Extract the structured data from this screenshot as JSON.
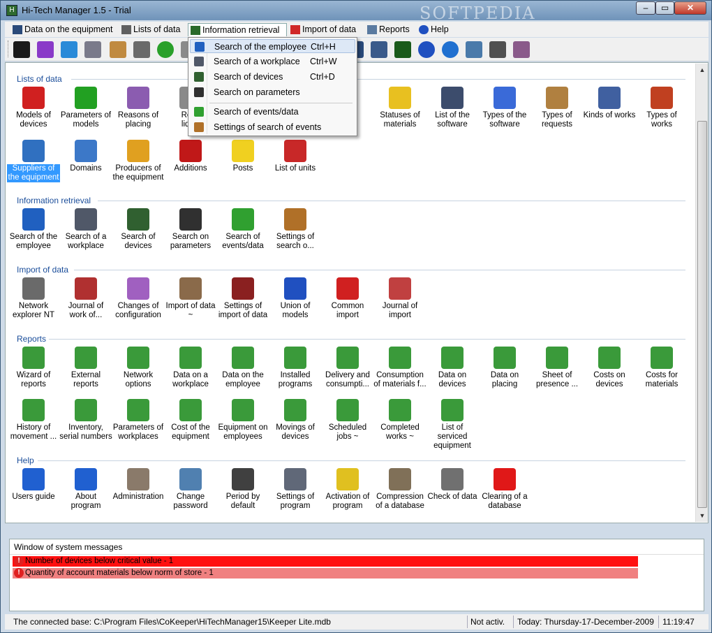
{
  "window": {
    "title": "Hi-Tech Manager 1.5 - Trial",
    "watermark": "SOFTPEDIA",
    "min_glyph": "‒",
    "max_glyph": "▭",
    "close_glyph": "✕"
  },
  "menu": {
    "data_equipment": "Data on the equipment",
    "lists": "Lists of data",
    "info": "Information retrieval",
    "import": "Import of data",
    "reports": "Reports",
    "help": "Help"
  },
  "toolbar": {
    "icons": [
      "tree-icon",
      "cube-purple-icon",
      "cube-blue-icon",
      "doors-icon",
      "pencil-book-icon",
      "clipboard-icon",
      "checkmark-icon",
      "hidden-icon",
      "hidden-icon",
      "hidden-icon",
      "hidden-icon",
      "hidden-icon",
      "hidden-icon",
      "hidden-icon",
      "hidden-icon",
      "hidden-icon",
      "hidden-icon",
      "hidden-icon",
      "hidden-icon",
      "computer-icon",
      "binoculars-icon",
      "help-icon",
      "info-icon",
      "stamp-icon",
      "magnifier-icon",
      "mug-icon"
    ]
  },
  "dropdown": {
    "items": [
      {
        "label": "Search of the employee",
        "shortcut": "Ctrl+H",
        "icon": "employee-icon"
      },
      {
        "label": "Search of a workplace",
        "shortcut": "Ctrl+W",
        "icon": "workplace-icon"
      },
      {
        "label": "Search of devices",
        "shortcut": "Ctrl+D",
        "icon": "binoculars-icon"
      },
      {
        "label": "Search on parameters",
        "shortcut": "",
        "icon": "binoculars-icon"
      },
      {
        "label": "Search of events/data",
        "shortcut": "",
        "icon": "magnifier-icon"
      },
      {
        "label": "Settings of search of events",
        "shortcut": "",
        "icon": "settings-icon"
      }
    ]
  },
  "sections": {
    "lists": {
      "title": "Lists of data",
      "row1": [
        {
          "l1": "Models of",
          "l2": "devices",
          "icon": "fireworks-icon",
          "color": "#d02020"
        },
        {
          "l1": "Parameters of",
          "l2": "models",
          "icon": "green-cube-icon",
          "color": "#22a022"
        },
        {
          "l1": "Reasons of",
          "l2": "placing",
          "icon": "calendar-icon",
          "color": "#8b5cb0"
        },
        {
          "l1": "Reas",
          "l2": "liquic",
          "icon": "doc-icon",
          "color": "#8a8a8a"
        },
        {
          "l1": "",
          "l2": "",
          "icon": "hidden-icon",
          "color": "#ffffff"
        },
        {
          "l1": "",
          "l2": "",
          "icon": "hidden-icon",
          "color": "#ffffff"
        },
        {
          "l1": "",
          "l2": "",
          "icon": "hidden-icon",
          "color": "#ffffff"
        },
        {
          "l1": "Statuses of",
          "l2": "materials",
          "icon": "folder-icon",
          "color": "#e8c020"
        },
        {
          "l1": "List of the",
          "l2": "software",
          "icon": "window-icon",
          "color": "#3c4c6c"
        },
        {
          "l1": "Types of the",
          "l2": "software",
          "icon": "globe-book-icon",
          "color": "#3a6ad8"
        },
        {
          "l1": "Types of",
          "l2": "requests",
          "icon": "compass-icon",
          "color": "#b08040"
        },
        {
          "l1": "Kinds of works",
          "l2": "",
          "icon": "tools-icon",
          "color": "#4060a0"
        },
        {
          "l1": "Types of",
          "l2": "works",
          "icon": "hammer-icon",
          "color": "#c04020"
        }
      ],
      "row2": [
        {
          "l1": "Suppliers of",
          "l2": "the equipment",
          "icon": "supplier-icon",
          "color": "#3070c0"
        },
        {
          "l1": "Domains",
          "l2": "",
          "icon": "network-icon",
          "color": "#3c78c8"
        },
        {
          "l1": "Producers of",
          "l2": "the equipment",
          "icon": "producer-icon",
          "color": "#e0a020"
        },
        {
          "l1": "Additions",
          "l2": "",
          "icon": "gems-icon",
          "color": "#c01818"
        },
        {
          "l1": "Posts",
          "l2": "",
          "icon": "envelope-icon",
          "color": "#f0d020"
        },
        {
          "l1": "List of units",
          "l2": "",
          "icon": "units-icon",
          "color": "#c82828"
        }
      ]
    },
    "info": {
      "title": "Information retrieval",
      "items": [
        {
          "l1": "Search of the",
          "l2": "employee",
          "icon": "employee-icon",
          "color": "#2060c0"
        },
        {
          "l1": "Search of a",
          "l2": "workplace",
          "icon": "workplace-icon",
          "color": "#505868"
        },
        {
          "l1": "Search of",
          "l2": "devices",
          "icon": "binoculars-icon",
          "color": "#306030"
        },
        {
          "l1": "Search on",
          "l2": "parameters",
          "icon": "binoculars-icon",
          "color": "#303030"
        },
        {
          "l1": "Search of",
          "l2": "events/data",
          "icon": "magnifier-icon",
          "color": "#30a030"
        },
        {
          "l1": "Settings of",
          "l2": "search o...",
          "icon": "settings-icon",
          "color": "#b07028"
        }
      ]
    },
    "import": {
      "title": "Import of data",
      "items": [
        {
          "l1": "Network",
          "l2": "explorer NT",
          "icon": "network-explorer-icon",
          "color": "#6a6a6a"
        },
        {
          "l1": "Journal of",
          "l2": "work of...",
          "icon": "journal-icon",
          "color": "#b03030"
        },
        {
          "l1": "Changes of",
          "l2": "configuration",
          "icon": "question-doc-icon",
          "color": "#a060c0"
        },
        {
          "l1": "Import of data",
          "l2": "~",
          "icon": "import-icon",
          "color": "#8a6a4a"
        },
        {
          "l1": "Settings of",
          "l2": "import of data",
          "icon": "settings-import-icon",
          "color": "#8a2020"
        },
        {
          "l1": "Union of",
          "l2": "models",
          "icon": "shapes-icon",
          "color": "#2050c0"
        },
        {
          "l1": "Common",
          "l2": "import",
          "icon": "arrows-icon",
          "color": "#d02020"
        },
        {
          "l1": "Journal of",
          "l2": "import",
          "icon": "import-journal-icon",
          "color": "#c04040"
        }
      ]
    },
    "reports": {
      "title": "Reports",
      "row1": [
        {
          "l1": "Wizard of",
          "l2": "reports"
        },
        {
          "l1": "External",
          "l2": "reports"
        },
        {
          "l1": "Network",
          "l2": "options"
        },
        {
          "l1": "Data on a",
          "l2": "workplace"
        },
        {
          "l1": "Data on the",
          "l2": "employee"
        },
        {
          "l1": "Installed",
          "l2": "programs"
        },
        {
          "l1": "Delivery and",
          "l2": "consumpti..."
        },
        {
          "l1": "Consumption",
          "l2": "of materials f..."
        },
        {
          "l1": "Data on",
          "l2": "devices"
        },
        {
          "l1": "Data on",
          "l2": "placing"
        },
        {
          "l1": "Sheet of",
          "l2": "presence ..."
        },
        {
          "l1": "Costs on",
          "l2": "devices"
        },
        {
          "l1": "Costs for",
          "l2": "materials"
        }
      ],
      "row2": [
        {
          "l1": "History of",
          "l2": "movement ..."
        },
        {
          "l1": "Inventory,",
          "l2": "serial numbers"
        },
        {
          "l1": "Parameters of",
          "l2": "workplaces"
        },
        {
          "l1": "Cost of the",
          "l2": "equipment"
        },
        {
          "l1": "Equipment on",
          "l2": "employees"
        },
        {
          "l1": "Movings of",
          "l2": "devices"
        },
        {
          "l1": "Scheduled",
          "l2": "jobs ~"
        },
        {
          "l1": "Completed",
          "l2": "works ~"
        },
        {
          "l1": "List of serviced",
          "l2": "equipment"
        }
      ]
    },
    "help": {
      "title": "Help",
      "items": [
        {
          "l1": "Users guide",
          "l2": "",
          "icon": "help-icon",
          "color": "#2060d0"
        },
        {
          "l1": "About program",
          "l2": "",
          "icon": "info-icon",
          "color": "#2060d0"
        },
        {
          "l1": "Administration",
          "l2": "",
          "icon": "keys-icon",
          "color": "#8a7a6a"
        },
        {
          "l1": "Change",
          "l2": "password",
          "icon": "stamp-icon",
          "color": "#5080b0"
        },
        {
          "l1": "Period by",
          "l2": "default",
          "icon": "magnifier-icon",
          "color": "#404040"
        },
        {
          "l1": "Settings of",
          "l2": "program",
          "icon": "settings-icon",
          "color": "#606878"
        },
        {
          "l1": "Activation of",
          "l2": "program",
          "icon": "key-icon",
          "color": "#e0c020"
        },
        {
          "l1": "Compression",
          "l2": "of a database",
          "icon": "database-icon",
          "color": "#807058"
        },
        {
          "l1": "Check of data",
          "l2": "",
          "icon": "check-data-icon",
          "color": "#707070"
        },
        {
          "l1": "Clearing of a",
          "l2": "database",
          "icon": "alert-icon",
          "color": "#e01818"
        }
      ]
    }
  },
  "messages": {
    "title": "Window of system messages",
    "rows": [
      {
        "text": "Number of devices below critical value - 1",
        "color": "#ff1010"
      },
      {
        "text": "Quantity of account materials below norm of store - 1",
        "color": "#f08080"
      }
    ]
  },
  "status": {
    "base": "The connected base: C:\\Program Files\\CoKeeper\\HiTechManager15\\Keeper Lite.mdb",
    "activ": "Not activ.",
    "today": "Today: Thursday-17-December-2009",
    "time": "11:19:47"
  },
  "colors": {
    "report_icon": "#3a9a3a",
    "section_title": "#1a4d9a",
    "selected": "#3399ff"
  }
}
